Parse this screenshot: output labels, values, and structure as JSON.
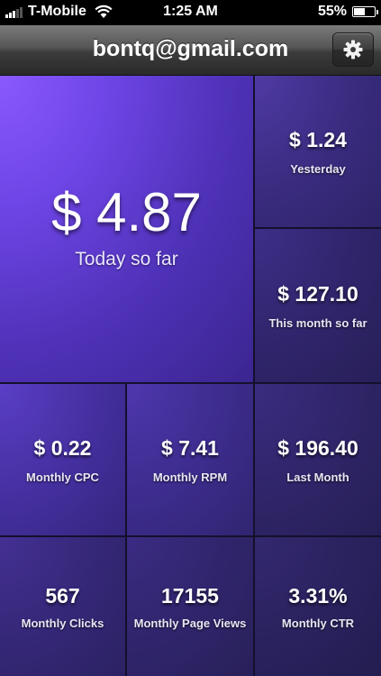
{
  "status_bar": {
    "carrier": "T-Mobile",
    "time": "1:25 AM",
    "battery_percent_text": "55%",
    "battery_level": 0.55,
    "signal_bars_on": 3,
    "signal_bars_total": 5
  },
  "header": {
    "title": "bontq@gmail.com",
    "settings_icon": "gear-icon"
  },
  "tiles": {
    "today": {
      "value": "$ 4.87",
      "label": "Today so far"
    },
    "yesterday": {
      "value": "$ 1.24",
      "label": "Yesterday"
    },
    "this_month": {
      "value": "$ 127.10",
      "label": "This month so far"
    },
    "cpc": {
      "value": "$ 0.22",
      "label": "Monthly CPC"
    },
    "rpm": {
      "value": "$ 7.41",
      "label": "Monthly RPM"
    },
    "last_month": {
      "value": "$ 196.40",
      "label": "Last Month"
    },
    "clicks": {
      "value": "567",
      "label": "Monthly Clicks"
    },
    "page_views": {
      "value": "17155",
      "label": "Monthly Page Views"
    },
    "ctr": {
      "value": "3.31%",
      "label": "Monthly CTR"
    }
  },
  "colors": {
    "accent": "#8a59ff",
    "tile_dark": "#231d50",
    "gridline": "#14102c"
  }
}
